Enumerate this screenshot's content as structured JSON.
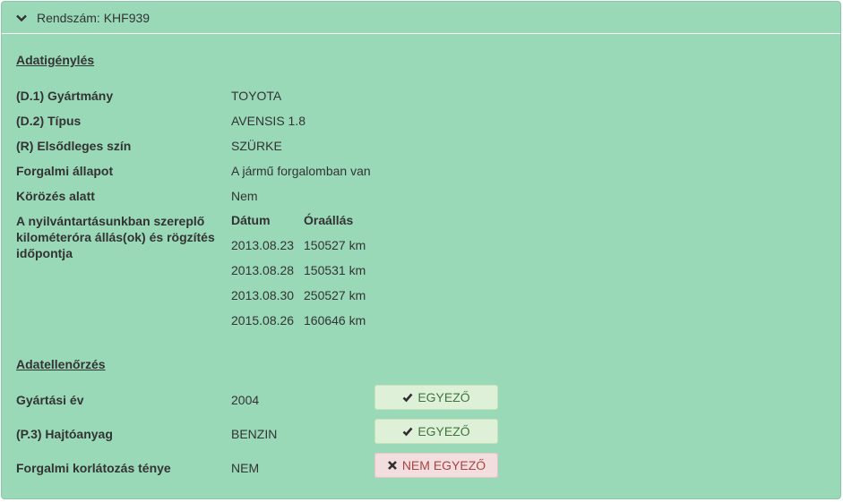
{
  "header": {
    "title": "Rendszám: KHF939",
    "icon": "chevron-down-icon"
  },
  "request": {
    "title": "Adatigénylés",
    "rows": [
      {
        "label": "(D.1) Gyártmány",
        "value": "TOYOTA"
      },
      {
        "label": "(D.2) Típus",
        "value": "AVENSIS 1.8"
      },
      {
        "label": "(R) Elsődleges szín",
        "value": "SZÜRKE"
      },
      {
        "label": "Forgalmi állapot",
        "value": "A jármű forgalomban van"
      },
      {
        "label": "Körözés alatt",
        "value": "Nem"
      }
    ],
    "odometer": {
      "label": "A nyilvántartásunkban szereplő kilométeróra állás(ok) és rögzítés időpontja",
      "col_date": "Dátum",
      "col_reading": "Óraállás",
      "entries": [
        {
          "date": "2013.08.23",
          "reading": "150527 km"
        },
        {
          "date": "2013.08.28",
          "reading": "150531 km"
        },
        {
          "date": "2013.08.30",
          "reading": "250527 km"
        },
        {
          "date": "2015.08.26",
          "reading": "160646 km"
        }
      ]
    }
  },
  "check": {
    "title": "Adatellenőrzés",
    "rows": [
      {
        "label": "Gyártási év",
        "value": "2004",
        "status": "EGYEZŐ",
        "status_icon": "check-icon"
      },
      {
        "label": "(P.3) Hajtóanyag",
        "value": "BENZIN",
        "status": "EGYEZŐ",
        "status_icon": "check-icon"
      },
      {
        "label": "Forgalmi korlátozás ténye",
        "value": "NEM",
        "status": "NEM EGYEZŐ",
        "status_icon": "x-icon"
      }
    ]
  },
  "colors": {
    "panel": "#99d9b8",
    "match_bg": "#dff0d8",
    "match_text": "#3c763d",
    "mismatch_bg": "#f2dede",
    "mismatch_text": "#a94442"
  }
}
